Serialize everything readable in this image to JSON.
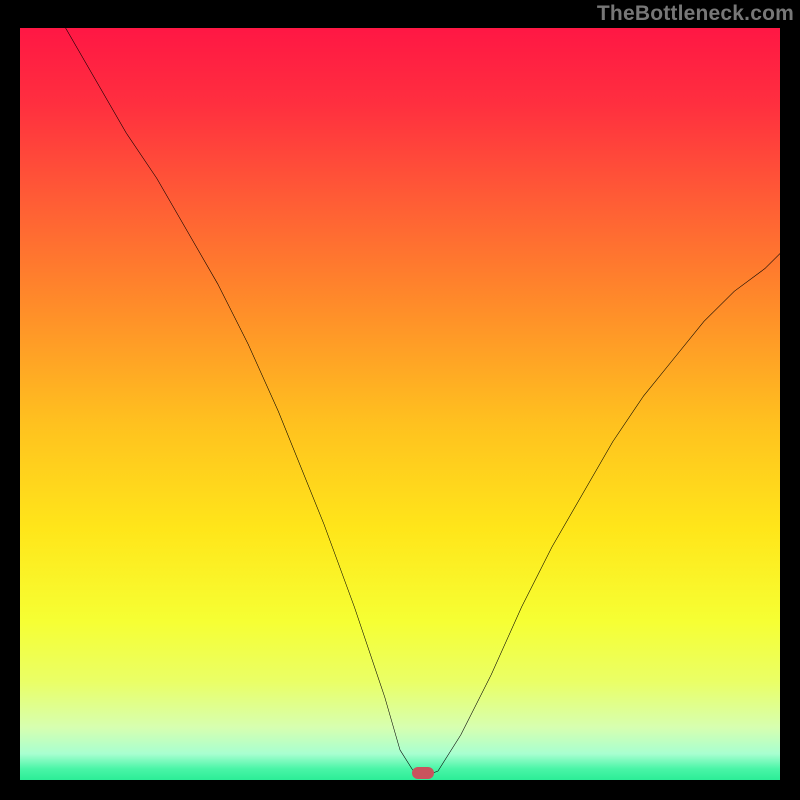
{
  "attribution": "TheBottleneck.com",
  "marker": {
    "color": "#c9535d"
  },
  "gradient_stops": [
    {
      "pos": 0.0,
      "color": "#ff1744"
    },
    {
      "pos": 0.1,
      "color": "#ff2f3f"
    },
    {
      "pos": 0.22,
      "color": "#ff5a36"
    },
    {
      "pos": 0.36,
      "color": "#ff8a2a"
    },
    {
      "pos": 0.52,
      "color": "#ffc11f"
    },
    {
      "pos": 0.66,
      "color": "#ffe61a"
    },
    {
      "pos": 0.78,
      "color": "#f6ff33"
    },
    {
      "pos": 0.86,
      "color": "#eaff66"
    },
    {
      "pos": 0.92,
      "color": "#d7ffb0"
    },
    {
      "pos": 0.955,
      "color": "#a8ffd0"
    },
    {
      "pos": 0.975,
      "color": "#49f5a7"
    },
    {
      "pos": 1.0,
      "color": "#16e78b"
    }
  ],
  "chart_data": {
    "type": "line",
    "title": "",
    "xlabel": "",
    "ylabel": "",
    "xlim": [
      0,
      100
    ],
    "ylim": [
      0,
      100
    ],
    "grid": false,
    "legend": false,
    "marker_x": 53,
    "series": [
      {
        "name": "curve",
        "x": [
          6,
          10,
          14,
          18,
          22,
          26,
          30,
          34,
          36,
          40,
          44,
          48,
          50,
          52,
          54,
          55,
          58,
          62,
          66,
          70,
          74,
          78,
          82,
          86,
          90,
          94,
          98,
          100
        ],
        "y": [
          100,
          93,
          86,
          80,
          73,
          66,
          58,
          49,
          44,
          34,
          23,
          11,
          4,
          0.8,
          0.8,
          1.2,
          6,
          14,
          23,
          31,
          38,
          45,
          51,
          56,
          61,
          65,
          68,
          70
        ]
      }
    ]
  }
}
